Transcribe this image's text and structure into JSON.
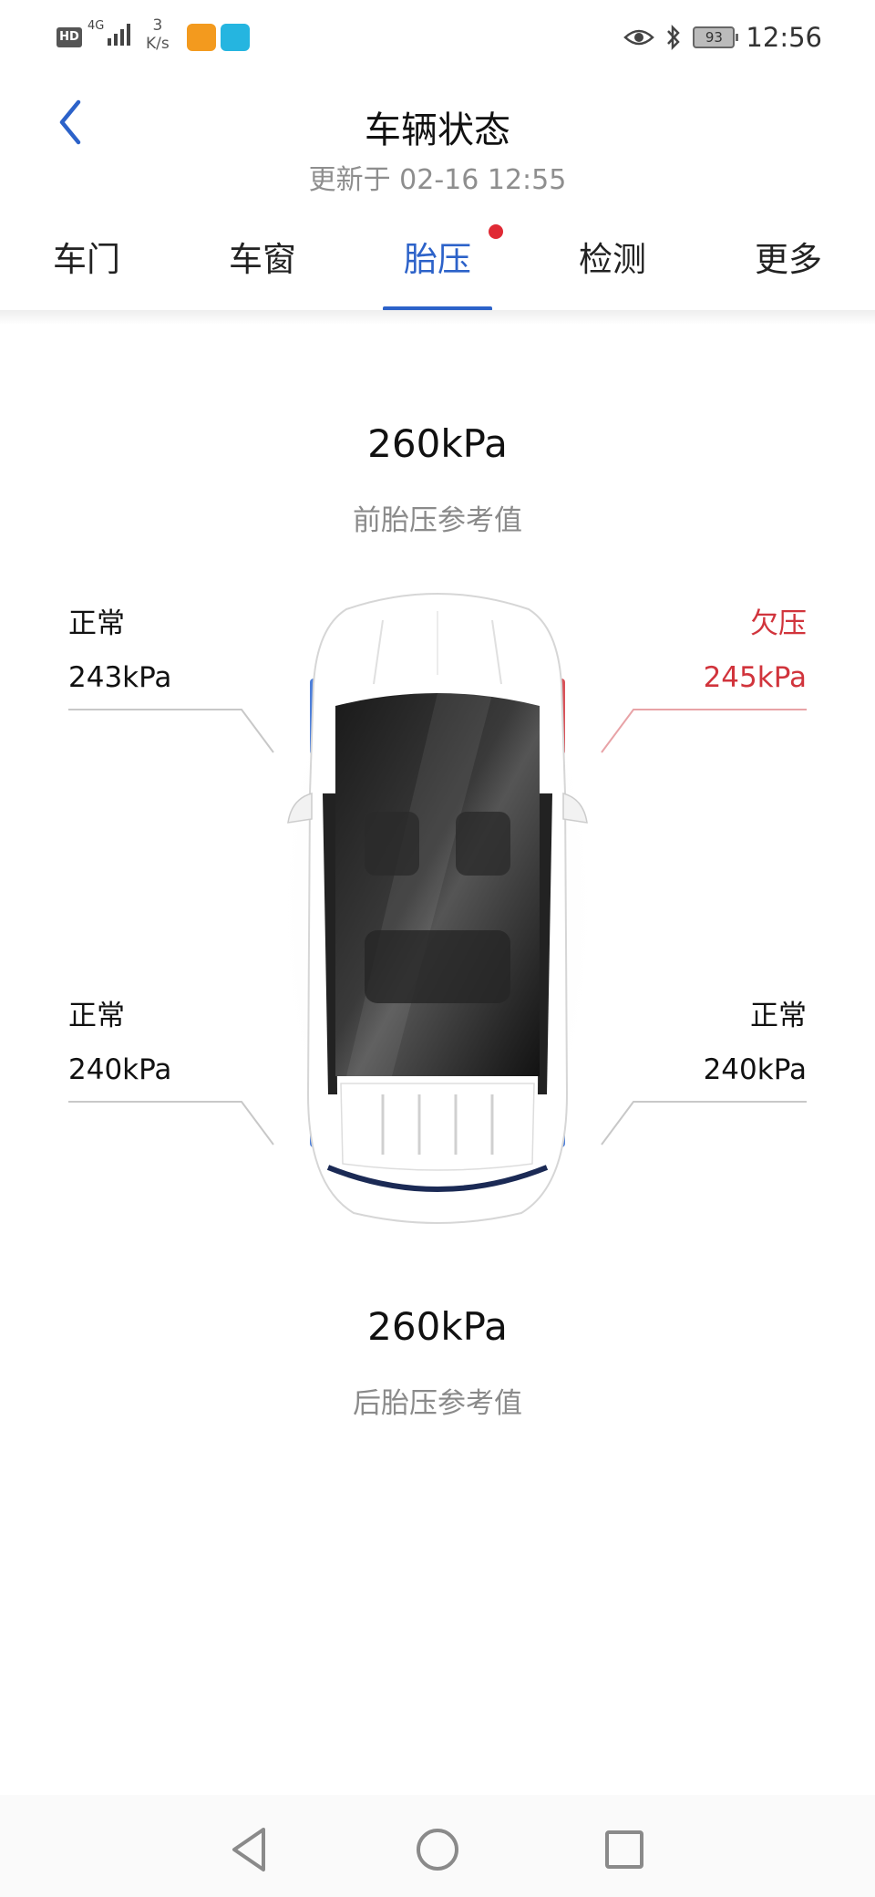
{
  "status_bar": {
    "hd": "HD",
    "network": "4G",
    "speed_value": "3",
    "speed_unit": "K/s",
    "battery": "93",
    "time": "12:56",
    "icons": [
      "hd-icon",
      "signal-icon",
      "uc-browser-icon",
      "reader-icon",
      "eye-icon",
      "bluetooth-icon",
      "battery-icon"
    ]
  },
  "header": {
    "title": "车辆状态",
    "subtitle": "更新于 02-16 12:55"
  },
  "tabs": [
    {
      "label": "车门"
    },
    {
      "label": "车窗"
    },
    {
      "label": "胎压"
    },
    {
      "label": "检测"
    },
    {
      "label": "更多"
    }
  ],
  "active_tab": "胎压",
  "front_reference": {
    "value": "260kPa",
    "label": "前胎压参考值"
  },
  "rear_reference": {
    "value": "260kPa",
    "label": "后胎压参考值"
  },
  "tires": {
    "front_left": {
      "status": "正常",
      "pressure": "243kPa"
    },
    "front_right": {
      "status": "欠压",
      "pressure": "245kPa"
    },
    "rear_left": {
      "status": "正常",
      "pressure": "240kPa"
    },
    "rear_right": {
      "status": "正常",
      "pressure": "240kPa"
    }
  },
  "colors": {
    "accent": "#2c62c9",
    "warning": "#d1343c",
    "notification_dot": "#e02a35",
    "normal_tire": "#2f6ad3"
  }
}
